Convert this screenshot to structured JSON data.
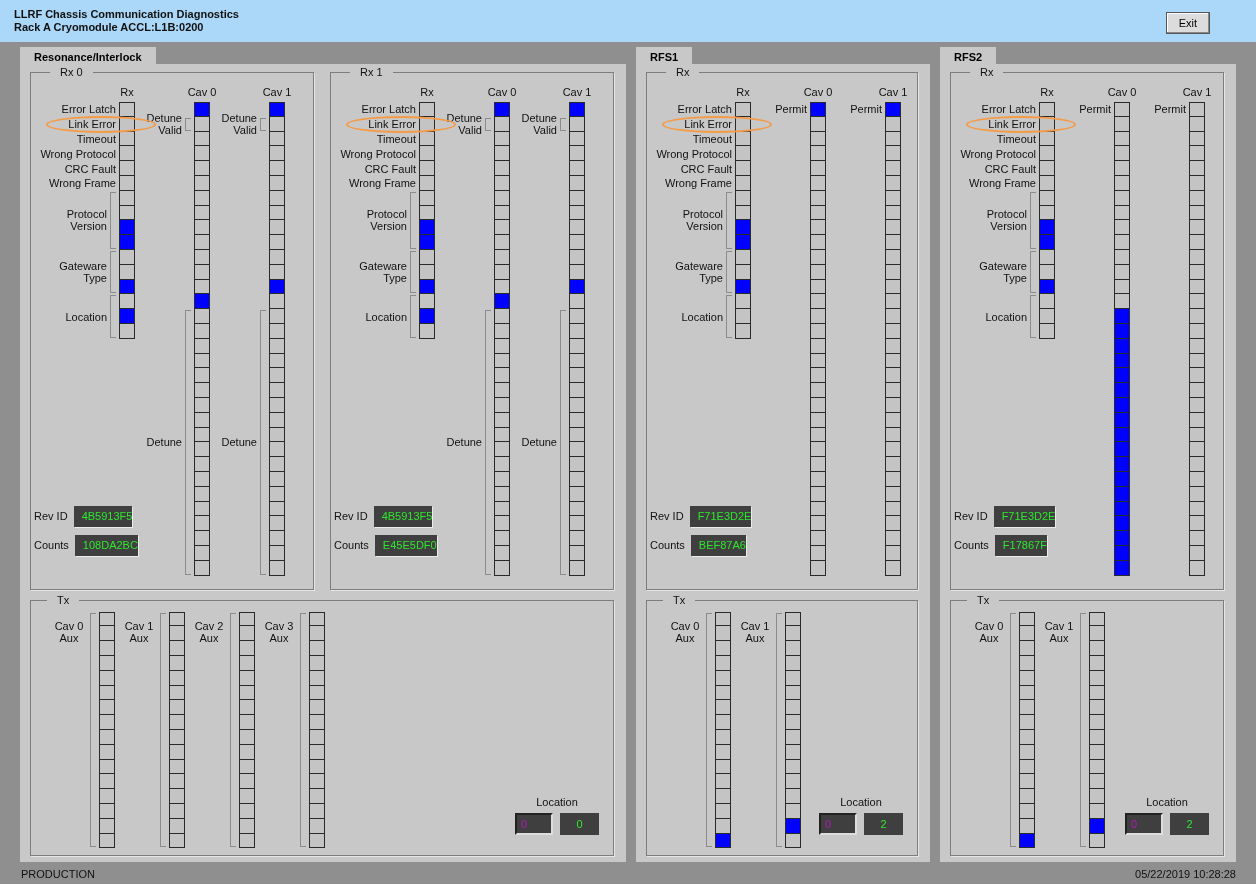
{
  "header": {
    "title": "LLRF Chassis Communication Diagnostics",
    "subtitle": "Rack A Cryomodule ACCL:L1B:0200",
    "exit_button": "Exit"
  },
  "panels": [
    {
      "tab": {
        "label": "Resonance/Interlock",
        "selected": true
      },
      "rx_frames": [
        {
          "title": "Rx 0",
          "fields": [
            {
              "label": "Rev ID",
              "value": "4B5913F5"
            },
            {
              "label": "Counts",
              "value": "108DA2BC"
            }
          ],
          "columns": [
            {
              "header": "Rx",
              "kind": "rx",
              "groups": [
                {
                  "label": "Error Latch",
                  "bracket": false,
                  "circled": false,
                  "bits": [
                    false
                  ]
                },
                {
                  "label": "Link Error",
                  "bracket": false,
                  "circled": true,
                  "bits": [
                    false
                  ]
                },
                {
                  "label": "Timeout",
                  "bracket": false,
                  "circled": false,
                  "bits": [
                    false
                  ]
                },
                {
                  "label": "Wrong Protocol",
                  "bracket": false,
                  "circled": false,
                  "bits": [
                    false
                  ]
                },
                {
                  "label": "CRC Fault",
                  "bracket": false,
                  "circled": false,
                  "bits": [
                    false
                  ]
                },
                {
                  "label": "Wrong Frame",
                  "bracket": false,
                  "circled": false,
                  "bits": [
                    false
                  ]
                },
                {
                  "label": "Protocol Version",
                  "bracket": true,
                  "circled": false,
                  "bits": [
                    false,
                    false,
                    true,
                    true
                  ]
                },
                {
                  "label": "Gateware Type",
                  "bracket": true,
                  "circled": false,
                  "bits": [
                    false,
                    false,
                    true
                  ]
                },
                {
                  "label": "Location",
                  "bracket": true,
                  "circled": false,
                  "bits": [
                    false,
                    true,
                    false
                  ]
                }
              ]
            },
            {
              "header": "Cav 0",
              "kind": "cav",
              "groups": [
                {
                  "bits": [
                    true
                  ]
                },
                {
                  "label": "Detune Valid",
                  "bracket": true,
                  "bits": [
                    false
                  ]
                },
                {
                  "bits": [
                    false,
                    false,
                    false,
                    false,
                    false,
                    false,
                    false,
                    false,
                    false,
                    false,
                    false,
                    true
                  ]
                },
                {
                  "label": "Detune",
                  "bracket": true,
                  "bits": [
                    false,
                    false,
                    false,
                    false,
                    false,
                    false,
                    false,
                    false,
                    false,
                    false,
                    false,
                    false,
                    false,
                    false,
                    false,
                    false,
                    false,
                    false
                  ]
                }
              ]
            },
            {
              "header": "Cav 1",
              "kind": "cav",
              "groups": [
                {
                  "bits": [
                    true
                  ]
                },
                {
                  "label": "Detune Valid",
                  "bracket": true,
                  "bits": [
                    false
                  ]
                },
                {
                  "bits": [
                    false,
                    false,
                    false,
                    false,
                    false,
                    false,
                    false,
                    false,
                    false,
                    false,
                    true,
                    false
                  ]
                },
                {
                  "label": "Detune",
                  "bracket": true,
                  "bits": [
                    false,
                    false,
                    false,
                    false,
                    false,
                    false,
                    false,
                    false,
                    false,
                    false,
                    false,
                    false,
                    false,
                    false,
                    false,
                    false,
                    false,
                    false
                  ]
                }
              ]
            }
          ]
        },
        {
          "title": "Rx 1",
          "fields": [
            {
              "label": "Rev ID",
              "value": "4B5913F5"
            },
            {
              "label": "Counts",
              "value": "E45E5DF0"
            }
          ],
          "columns": [
            {
              "header": "Rx",
              "kind": "rx",
              "groups": [
                {
                  "label": "Error Latch",
                  "bracket": false,
                  "circled": false,
                  "bits": [
                    false
                  ]
                },
                {
                  "label": "Link Error",
                  "bracket": false,
                  "circled": true,
                  "bits": [
                    false
                  ]
                },
                {
                  "label": "Timeout",
                  "bracket": false,
                  "circled": false,
                  "bits": [
                    false
                  ]
                },
                {
                  "label": "Wrong Protocol",
                  "bracket": false,
                  "circled": false,
                  "bits": [
                    false
                  ]
                },
                {
                  "label": "CRC Fault",
                  "bracket": false,
                  "circled": false,
                  "bits": [
                    false
                  ]
                },
                {
                  "label": "Wrong Frame",
                  "bracket": false,
                  "circled": false,
                  "bits": [
                    false
                  ]
                },
                {
                  "label": "Protocol Version",
                  "bracket": true,
                  "circled": false,
                  "bits": [
                    false,
                    false,
                    true,
                    true
                  ]
                },
                {
                  "label": "Gateware Type",
                  "bracket": true,
                  "circled": false,
                  "bits": [
                    false,
                    false,
                    true
                  ]
                },
                {
                  "label": "Location",
                  "bracket": true,
                  "circled": false,
                  "bits": [
                    false,
                    true,
                    false
                  ]
                }
              ]
            },
            {
              "header": "Cav 0",
              "kind": "cav",
              "groups": [
                {
                  "bits": [
                    true
                  ]
                },
                {
                  "label": "Detune Valid",
                  "bracket": true,
                  "bits": [
                    false
                  ]
                },
                {
                  "bits": [
                    false,
                    false,
                    false,
                    false,
                    false,
                    false,
                    false,
                    false,
                    false,
                    false,
                    false,
                    true
                  ]
                },
                {
                  "label": "Detune",
                  "bracket": true,
                  "bits": [
                    false,
                    false,
                    false,
                    false,
                    false,
                    false,
                    false,
                    false,
                    false,
                    false,
                    false,
                    false,
                    false,
                    false,
                    false,
                    false,
                    false,
                    false
                  ]
                }
              ]
            },
            {
              "header": "Cav 1",
              "kind": "cav",
              "groups": [
                {
                  "bits": [
                    true
                  ]
                },
                {
                  "label": "Detune Valid",
                  "bracket": true,
                  "bits": [
                    false
                  ]
                },
                {
                  "bits": [
                    false,
                    false,
                    false,
                    false,
                    false,
                    false,
                    false,
                    false,
                    false,
                    false,
                    true,
                    false
                  ]
                },
                {
                  "label": "Detune",
                  "bracket": true,
                  "bits": [
                    false,
                    false,
                    false,
                    false,
                    false,
                    false,
                    false,
                    false,
                    false,
                    false,
                    false,
                    false,
                    false,
                    false,
                    false,
                    false,
                    false,
                    false
                  ]
                }
              ]
            }
          ]
        }
      ],
      "tx_frame": {
        "title": "Tx",
        "columns": [
          {
            "label": "Cav 0 Aux",
            "bits": [
              false,
              false,
              false,
              false,
              false,
              false,
              false,
              false,
              false,
              false,
              false,
              false,
              false,
              false,
              false,
              false
            ]
          },
          {
            "label": "Cav 1 Aux",
            "bits": [
              false,
              false,
              false,
              false,
              false,
              false,
              false,
              false,
              false,
              false,
              false,
              false,
              false,
              false,
              false,
              false
            ]
          },
          {
            "label": "Cav 2 Aux",
            "bits": [
              false,
              false,
              false,
              false,
              false,
              false,
              false,
              false,
              false,
              false,
              false,
              false,
              false,
              false,
              false,
              false
            ]
          },
          {
            "label": "Cav 3 Aux",
            "bits": [
              false,
              false,
              false,
              false,
              false,
              false,
              false,
              false,
              false,
              false,
              false,
              false,
              false,
              false,
              false,
              false
            ]
          }
        ],
        "location": {
          "label": "Location",
          "input": "0",
          "value": "0"
        }
      }
    },
    {
      "tab": {
        "label": "RFS1",
        "selected": true
      },
      "rx_frames": [
        {
          "title": "Rx",
          "fields": [
            {
              "label": "Rev ID",
              "value": "F71E3D2E"
            },
            {
              "label": "Counts",
              "value": "BEF87A6"
            }
          ],
          "columns": [
            {
              "header": "Rx",
              "kind": "rx",
              "groups": [
                {
                  "label": "Error Latch",
                  "bracket": false,
                  "circled": false,
                  "bits": [
                    false
                  ]
                },
                {
                  "label": "Link Error",
                  "bracket": false,
                  "circled": true,
                  "bits": [
                    false
                  ]
                },
                {
                  "label": "Timeout",
                  "bracket": false,
                  "circled": false,
                  "bits": [
                    false
                  ]
                },
                {
                  "label": "Wrong Protocol",
                  "bracket": false,
                  "circled": false,
                  "bits": [
                    false
                  ]
                },
                {
                  "label": "CRC Fault",
                  "bracket": false,
                  "circled": false,
                  "bits": [
                    false
                  ]
                },
                {
                  "label": "Wrong Frame",
                  "bracket": false,
                  "circled": false,
                  "bits": [
                    false
                  ]
                },
                {
                  "label": "Protocol Version",
                  "bracket": true,
                  "circled": false,
                  "bits": [
                    false,
                    false,
                    true,
                    true
                  ]
                },
                {
                  "label": "Gateware Type",
                  "bracket": true,
                  "circled": false,
                  "bits": [
                    false,
                    false,
                    true
                  ]
                },
                {
                  "label": "Location",
                  "bracket": true,
                  "circled": false,
                  "bits": [
                    false,
                    false,
                    false
                  ]
                }
              ]
            },
            {
              "header": "Cav 0",
              "kind": "cav",
              "groups": [
                {
                  "label": "Permit",
                  "bracket": false,
                  "bits": [
                    true
                  ]
                },
                {
                  "bits": [
                    false,
                    false,
                    false,
                    false,
                    false,
                    false,
                    false,
                    false,
                    false,
                    false,
                    false,
                    false,
                    false,
                    false,
                    false,
                    false,
                    false,
                    false,
                    false,
                    false,
                    false,
                    false,
                    false,
                    false,
                    false,
                    false,
                    false,
                    false,
                    false,
                    false,
                    false
                  ]
                }
              ]
            },
            {
              "header": "Cav 1",
              "kind": "cav",
              "groups": [
                {
                  "label": "Permit",
                  "bracket": false,
                  "bits": [
                    true
                  ]
                },
                {
                  "bits": [
                    false,
                    false,
                    false,
                    false,
                    false,
                    false,
                    false,
                    false,
                    false,
                    false,
                    false,
                    false,
                    false,
                    false,
                    false,
                    false,
                    false,
                    false,
                    false,
                    false,
                    false,
                    false,
                    false,
                    false,
                    false,
                    false,
                    false,
                    false,
                    false,
                    false,
                    false
                  ]
                }
              ]
            }
          ]
        }
      ],
      "tx_frame": {
        "title": "Tx",
        "columns": [
          {
            "label": "Cav 0 Aux",
            "bits": [
              false,
              false,
              false,
              false,
              false,
              false,
              false,
              false,
              false,
              false,
              false,
              false,
              false,
              false,
              false,
              true
            ]
          },
          {
            "label": "Cav 1 Aux",
            "bits": [
              false,
              false,
              false,
              false,
              false,
              false,
              false,
              false,
              false,
              false,
              false,
              false,
              false,
              false,
              true,
              false
            ]
          }
        ],
        "location": {
          "label": "Location",
          "input": "0",
          "value": "2"
        }
      }
    },
    {
      "tab": {
        "label": "RFS2",
        "selected": true
      },
      "rx_frames": [
        {
          "title": "Rx",
          "fields": [
            {
              "label": "Rev ID",
              "value": "F71E3D2E"
            },
            {
              "label": "Counts",
              "value": "F17867F"
            }
          ],
          "columns": [
            {
              "header": "Rx",
              "kind": "rx",
              "groups": [
                {
                  "label": "Error Latch",
                  "bracket": false,
                  "circled": false,
                  "bits": [
                    false
                  ]
                },
                {
                  "label": "Link Error",
                  "bracket": false,
                  "circled": true,
                  "bits": [
                    false
                  ]
                },
                {
                  "label": "Timeout",
                  "bracket": false,
                  "circled": false,
                  "bits": [
                    false
                  ]
                },
                {
                  "label": "Wrong Protocol",
                  "bracket": false,
                  "circled": false,
                  "bits": [
                    false
                  ]
                },
                {
                  "label": "CRC Fault",
                  "bracket": false,
                  "circled": false,
                  "bits": [
                    false
                  ]
                },
                {
                  "label": "Wrong Frame",
                  "bracket": false,
                  "circled": false,
                  "bits": [
                    false
                  ]
                },
                {
                  "label": "Protocol Version",
                  "bracket": true,
                  "circled": false,
                  "bits": [
                    false,
                    false,
                    true,
                    true
                  ]
                },
                {
                  "label": "Gateware Type",
                  "bracket": true,
                  "circled": false,
                  "bits": [
                    false,
                    false,
                    true
                  ]
                },
                {
                  "label": "Location",
                  "bracket": true,
                  "circled": false,
                  "bits": [
                    false,
                    false,
                    false
                  ]
                }
              ]
            },
            {
              "header": "Cav 0",
              "kind": "cav",
              "groups": [
                {
                  "label": "Permit",
                  "bracket": false,
                  "bits": [
                    false
                  ]
                },
                {
                  "bits": [
                    false,
                    false,
                    false,
                    false,
                    false,
                    false,
                    false,
                    false,
                    false,
                    false,
                    false,
                    false,
                    false,
                    true,
                    true,
                    true,
                    true,
                    true,
                    true,
                    true,
                    true,
                    true,
                    true,
                    true,
                    true,
                    true,
                    true,
                    true,
                    true,
                    true,
                    true
                  ]
                }
              ]
            },
            {
              "header": "Cav 1",
              "kind": "cav",
              "groups": [
                {
                  "label": "Permit",
                  "bracket": false,
                  "bits": [
                    false
                  ]
                },
                {
                  "bits": [
                    false,
                    false,
                    false,
                    false,
                    false,
                    false,
                    false,
                    false,
                    false,
                    false,
                    false,
                    false,
                    false,
                    false,
                    false,
                    false,
                    false,
                    false,
                    false,
                    false,
                    false,
                    false,
                    false,
                    false,
                    false,
                    false,
                    false,
                    false,
                    false,
                    false,
                    false
                  ]
                }
              ]
            }
          ]
        }
      ],
      "tx_frame": {
        "title": "Tx",
        "columns": [
          {
            "label": "Cav 0 Aux",
            "bits": [
              false,
              false,
              false,
              false,
              false,
              false,
              false,
              false,
              false,
              false,
              false,
              false,
              false,
              false,
              false,
              true
            ]
          },
          {
            "label": "Cav 1 Aux",
            "bits": [
              false,
              false,
              false,
              false,
              false,
              false,
              false,
              false,
              false,
              false,
              false,
              false,
              false,
              false,
              true,
              false
            ]
          }
        ],
        "location": {
          "label": "Location",
          "input": "0",
          "value": "2"
        }
      }
    }
  ],
  "status_bar": {
    "mode": "PRODUCTION",
    "timestamp": "05/22/2019 10:28:28"
  }
}
